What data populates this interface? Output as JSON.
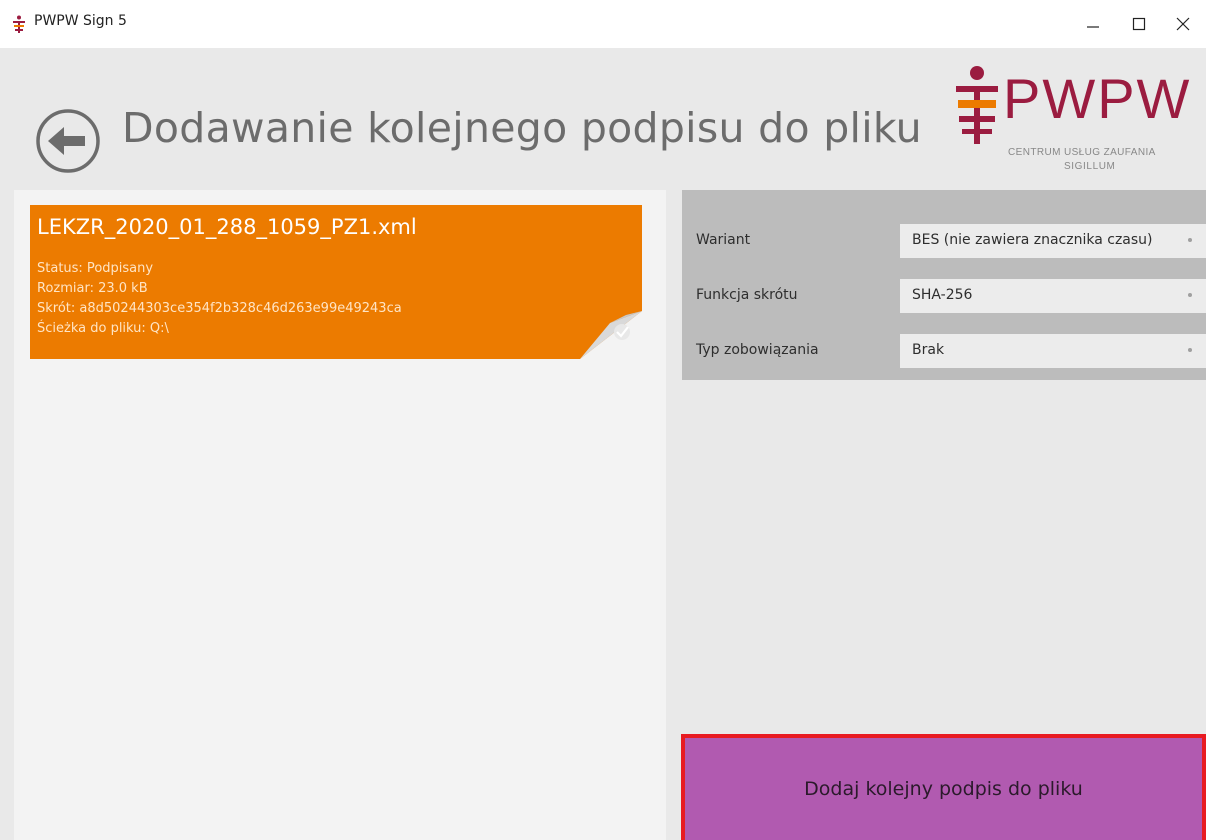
{
  "window": {
    "title": "PWPW Sign 5",
    "minimize_glyph": "—",
    "maximize_glyph": "☐",
    "close_glyph": "✕"
  },
  "header": {
    "title": "Dodawanie kolejnego podpisu do pliku",
    "logo": {
      "name": "PWPW",
      "subtitle_line1": "CENTRUM USŁUG ZAUFANIA",
      "subtitle_line2": "SIGILLUM",
      "color": "#9b1c40"
    }
  },
  "file": {
    "name": "LEKZR_2020_01_288_1059_PZ1.xml",
    "status": "Status: Podpisany",
    "size": "Rozmiar: 23.0 kB",
    "hash": "Skrót: a8d50244303ce354f2b328c46d263e99e49243ca",
    "path": "Ścieżka do pliku: Q:\\",
    "card_color": "#ec7b00"
  },
  "settings": {
    "fields": [
      {
        "label": "Wariant",
        "value": "BES (nie zawiera znacznika czasu)"
      },
      {
        "label": "Funkcja skrótu",
        "value": "SHA-256"
      },
      {
        "label": "Typ zobowiązania",
        "value": "Brak"
      }
    ]
  },
  "action": {
    "label": "Dodaj kolejny podpis do pliku",
    "color": "#b15ab0",
    "highlight_color": "#e81b22"
  },
  "icons": {
    "app": "pwpw-app-icon",
    "back": "back-arrow-icon",
    "check": "check-icon"
  }
}
